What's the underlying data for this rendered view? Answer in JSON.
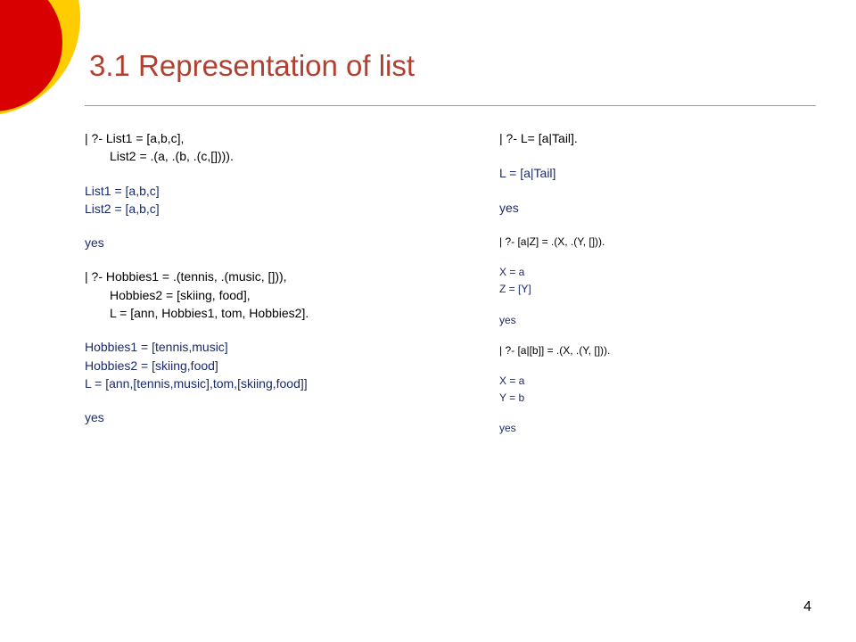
{
  "title": "3.1 Representation of list",
  "pageNumber": "4",
  "left": {
    "q1a": "| ?- List1 = [a,b,c],",
    "q1b": "List2 = .(a, .(b, .(c,[]))).",
    "r1a": "List1 = [a,b,c]",
    "r1b": "List2 = [a,b,c]",
    "yes1": "yes",
    "q2a": "| ?- Hobbies1 = .(tennis, .(music, [])),",
    "q2b": "Hobbies2 = [skiing, food],",
    "q2c": "L = [ann, Hobbies1, tom, Hobbies2].",
    "r2a": "Hobbies1 = [tennis,music]",
    "r2b": "Hobbies2 = [skiing,food]",
    "r2c": "L = [ann,[tennis,music],tom,[skiing,food]]",
    "yes2": "yes"
  },
  "right": {
    "q1": "| ?- L= [a|Tail].",
    "r1": "L = [a|Tail]",
    "yes1": "yes",
    "q2": "| ?- [a|Z] = .(X, .(Y, [])).",
    "r2a": "X = a",
    "r2b": "Z = [Y]",
    "yes2": "yes",
    "q3": "| ?- [a|[b]] = .(X, .(Y, [])).",
    "r3a": "X = a",
    "r3b": "Y = b",
    "yes3": "yes"
  }
}
